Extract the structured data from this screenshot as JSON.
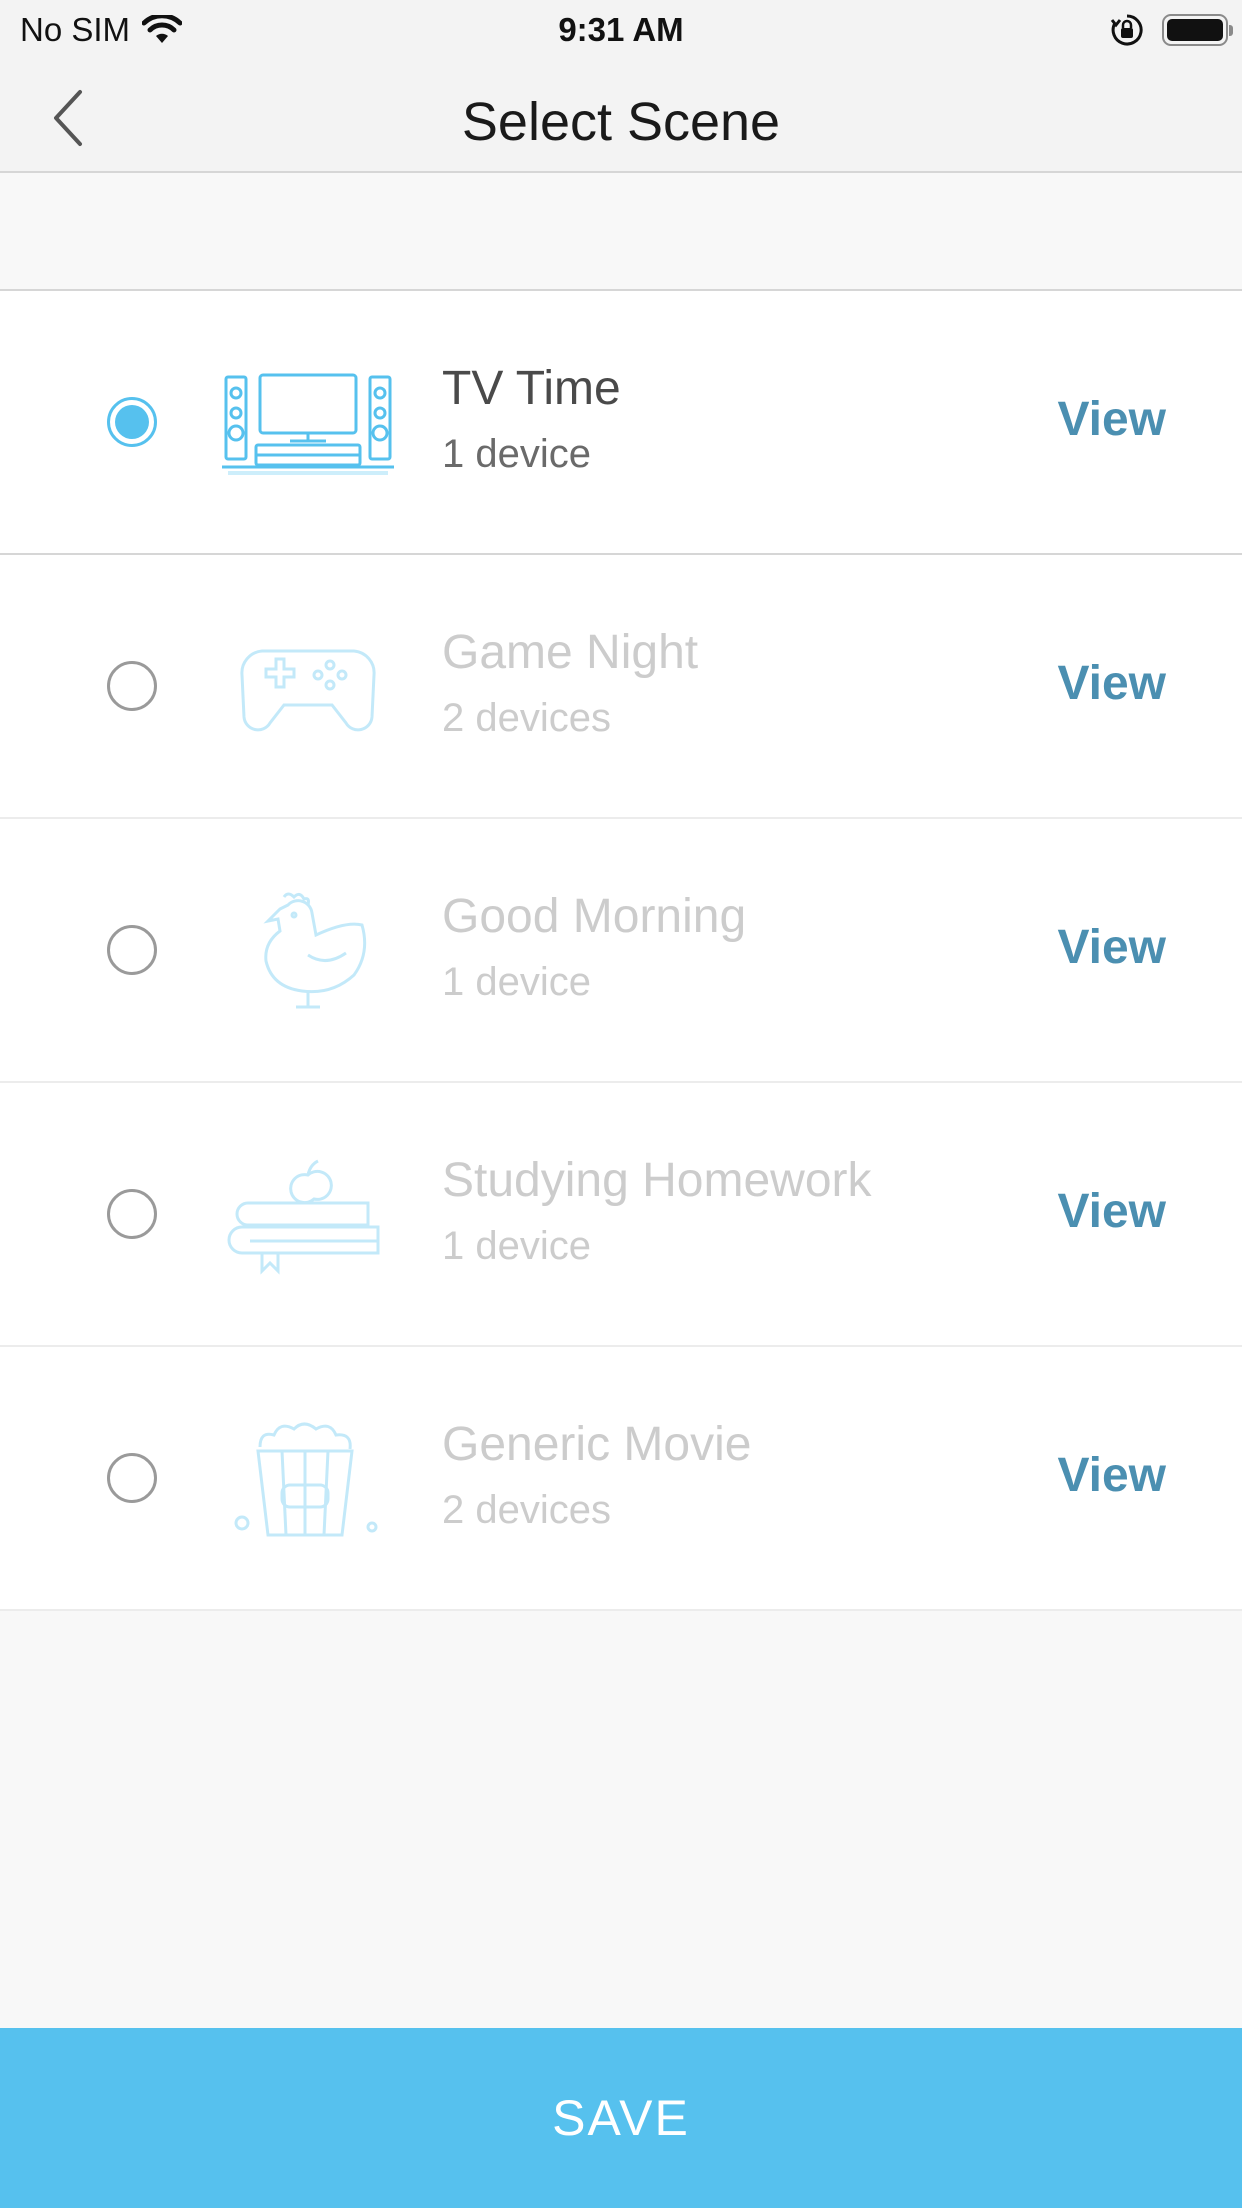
{
  "status_bar": {
    "carrier": "No SIM",
    "time": "9:31 AM",
    "wifi_icon": "wifi-icon",
    "lock_icon": "rotation-lock-icon",
    "battery_icon": "battery-icon"
  },
  "nav": {
    "title": "Select Scene",
    "back_icon": "chevron-left-icon"
  },
  "scenes": [
    {
      "name": "TV Time",
      "count": "1 device",
      "view_label": "View",
      "selected": true,
      "icon": "tv-icon"
    },
    {
      "name": "Game Night",
      "count": "2 devices",
      "view_label": "View",
      "selected": false,
      "icon": "gamepad-icon"
    },
    {
      "name": "Good Morning",
      "count": "1 device",
      "view_label": "View",
      "selected": false,
      "icon": "rooster-icon"
    },
    {
      "name": "Studying Homework",
      "count": "1 device",
      "view_label": "View",
      "selected": false,
      "icon": "books-apple-icon"
    },
    {
      "name": "Generic Movie",
      "count": "2 devices",
      "view_label": "View",
      "selected": false,
      "icon": "popcorn-icon"
    }
  ],
  "save_label": "SAVE",
  "colors": {
    "accent": "#56c1ee",
    "link": "#4b8fb1",
    "disabled_text": "#cccccc"
  }
}
